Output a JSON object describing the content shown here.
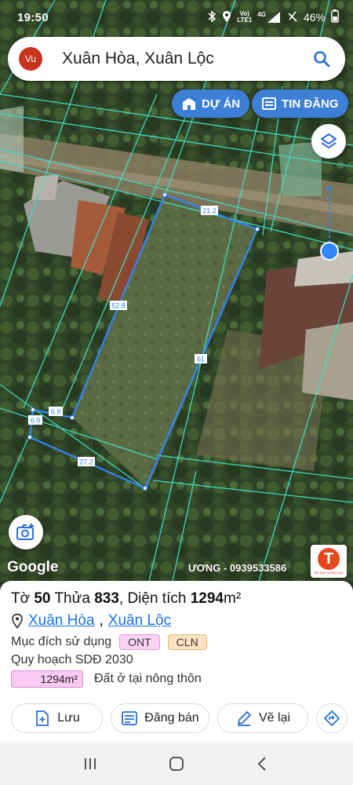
{
  "status_bar": {
    "time": "19:50",
    "network_top": "Vo)",
    "network_bottom": "LTE1",
    "signal_label": "4G",
    "battery": "46%"
  },
  "search": {
    "avatar_initials": "Vu",
    "query": "Xuân Hòa, Xuân Lộc"
  },
  "map": {
    "buttons": {
      "projects": "DỰ ÁN",
      "listings": "TIN ĐĂNG"
    },
    "measurements": [
      "21.2",
      "52.8",
      "61",
      "6.9",
      "6.9",
      "27.2"
    ],
    "google_label": "Google",
    "watermark": "ƯƠNG - 0939533586",
    "brand_logo_letter": "T",
    "brand_small": "ĐO ĐẠC ĐỒNG NAI",
    "colors": {
      "parcel_outline": "#2f86ff",
      "grid_lines": "#3fe0c8",
      "accent": "#3d7fd6"
    }
  },
  "parcel": {
    "sheet_label": "Tờ",
    "sheet_no": "50",
    "plot_label": "Thửa",
    "plot_no": "833",
    "area_label": "Diện tích",
    "area_value": "1294",
    "area_unit": "m²",
    "commune": "Xuân Hòa",
    "district": "Xuân Lộc",
    "purpose_label": "Mục đích sử dụng",
    "purpose_tags": [
      "ONT",
      "CLN"
    ],
    "planning_label": "Quy hoạch SDĐ 2030",
    "planning_area": "1294m²",
    "planning_desc": "Đất ở tại nông thôn"
  },
  "actions": {
    "save": "Lưu",
    "post_sale": "Đăng bán",
    "redraw": "Vẽ lại"
  }
}
